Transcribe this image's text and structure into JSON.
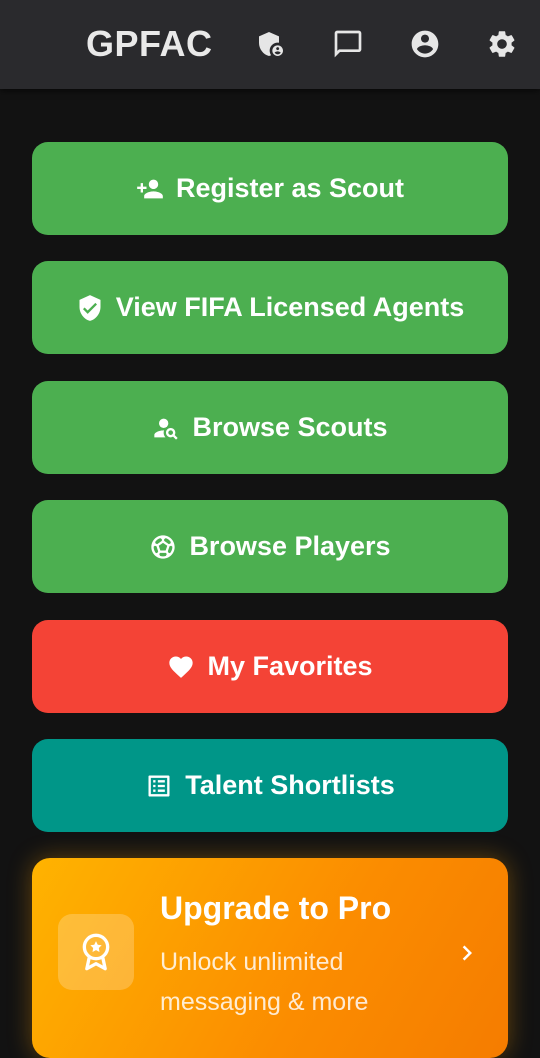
{
  "appbar": {
    "title": "GPFAC",
    "icons": [
      "admin-shield-icon",
      "chat-icon",
      "account-circle-icon",
      "settings-gear-icon"
    ]
  },
  "buttons": {
    "register_scout": {
      "label": "Register as Scout",
      "icon": "person-add-icon",
      "color": "#4caf50"
    },
    "fifa_agents": {
      "label": "View FIFA Licensed Agents",
      "icon": "verified-shield-icon",
      "color": "#4caf50"
    },
    "browse_scouts": {
      "label": "Browse Scouts",
      "icon": "person-search-icon",
      "color": "#4caf50"
    },
    "browse_players": {
      "label": "Browse Players",
      "icon": "soccer-ball-icon",
      "color": "#4caf50"
    },
    "favorites": {
      "label": "My Favorites",
      "icon": "heart-icon",
      "color": "#f44336"
    },
    "shortlists": {
      "label": "Talent Shortlists",
      "icon": "list-alt-icon",
      "color": "#009688"
    }
  },
  "pro_card": {
    "title": "Upgrade to Pro",
    "subtitle": "Unlock unlimited messaging & more",
    "icon": "award-badge-icon",
    "action_icon": "chevron-right-icon"
  }
}
